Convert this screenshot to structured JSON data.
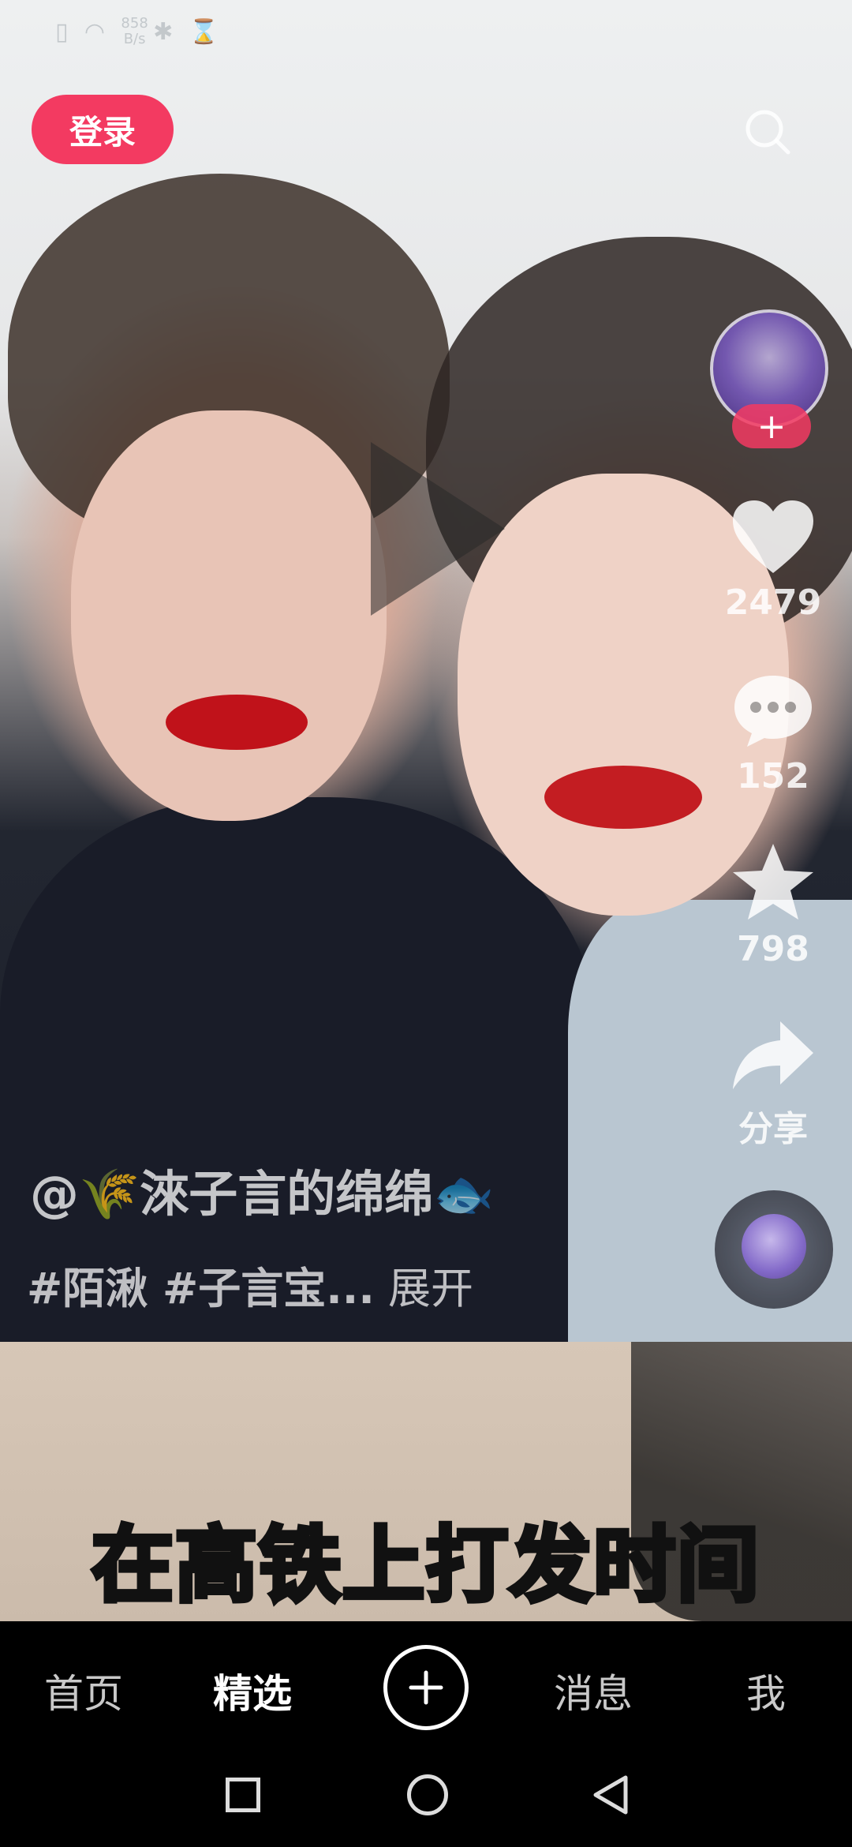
{
  "status_bar": {
    "speed_value": "858",
    "speed_unit": "B/s"
  },
  "header": {
    "login_label": "登录",
    "search_icon": "search-icon"
  },
  "actions": {
    "likes": "2479",
    "comments": "152",
    "favorites": "798",
    "share_label": "分享"
  },
  "post": {
    "author": "@🌾淶子言的绵绵🐟",
    "caption_tags": "#陌湫 #子言宝...",
    "expand_label": "展开"
  },
  "next_video": {
    "subtitle": "在高铁上打发时间"
  },
  "tabbar": {
    "home": "首页",
    "featured": "精选",
    "messages": "消息",
    "me": "我"
  },
  "colors": {
    "accent": "#f33a61",
    "subtitle": "#f6e82a"
  }
}
